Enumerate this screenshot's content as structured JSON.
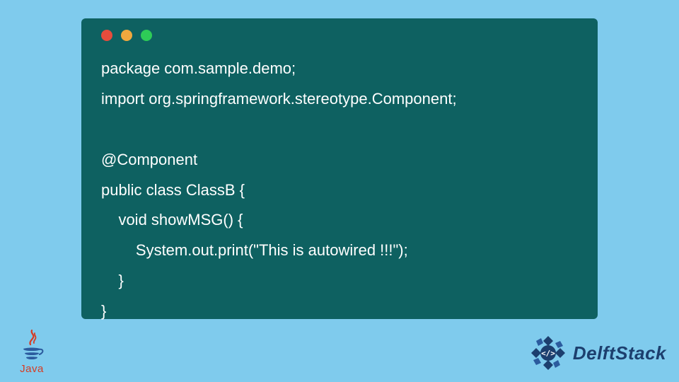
{
  "window": {
    "traffic_lights": [
      "red",
      "yellow",
      "green"
    ]
  },
  "code": {
    "lines": [
      "package com.sample.demo;",
      "import org.springframework.stereotype.Component;",
      "",
      "@Component",
      "public class ClassB {",
      "    void showMSG() {",
      "        System.out.print(\"This is autowired !!!\");",
      "    }",
      "}"
    ]
  },
  "logos": {
    "java_label": "Java",
    "brand_name": "DelftStack"
  },
  "colors": {
    "page_bg": "#7fcbed",
    "window_bg": "#0e6161",
    "code_text": "#ffffff",
    "brand_text": "#1c3f6e",
    "java_text": "#d63b23"
  }
}
